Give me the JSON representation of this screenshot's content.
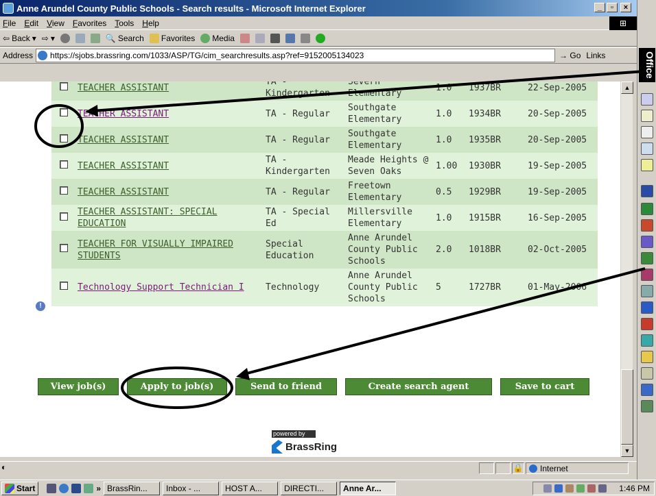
{
  "window": {
    "title": "Anne Arundel County Public Schools - Search results - Microsoft Internet Explorer"
  },
  "menu": [
    "File",
    "Edit",
    "View",
    "Favorites",
    "Tools",
    "Help"
  ],
  "toolbar": {
    "back": "Back",
    "search": "Search",
    "favorites": "Favorites",
    "media": "Media"
  },
  "address": {
    "label": "Address",
    "url": "https://sjobs.brassring.com/1033/ASP/TG/cim_searchresults.asp?ref=9152005134023",
    "go": "Go",
    "links": "Links"
  },
  "jobs": [
    {
      "title": "TEACHER ASSISTANT",
      "type": "TA - Kindergarten",
      "location": "Severn Elementary",
      "fte": "1.0",
      "req": "1937BR",
      "date": "22-Sep-2005"
    },
    {
      "title": "TEACHER ASSISTANT",
      "type": "TA - Regular",
      "location": "Southgate Elementary",
      "fte": "1.0",
      "req": "1934BR",
      "date": "20-Sep-2005"
    },
    {
      "title": "TEACHER ASSISTANT",
      "type": "TA - Regular",
      "location": "Southgate Elementary",
      "fte": "1.0",
      "req": "1935BR",
      "date": "20-Sep-2005"
    },
    {
      "title": "TEACHER ASSISTANT",
      "type": "TA - Kindergarten",
      "location": "Meade Heights @ Seven Oaks",
      "fte": "1.00",
      "req": "1930BR",
      "date": "19-Sep-2005"
    },
    {
      "title": "TEACHER ASSISTANT",
      "type": "TA - Regular",
      "location": "Freetown Elementary",
      "fte": "0.5",
      "req": "1929BR",
      "date": "19-Sep-2005"
    },
    {
      "title": "TEACHER ASSISTANT: SPECIAL EDUCATION",
      "type": "TA - Special Ed",
      "location": "Millersville Elementary",
      "fte": "1.0",
      "req": "1915BR",
      "date": "16-Sep-2005"
    },
    {
      "title": "TEACHER FOR VISUALLY IMPAIRED STUDENTS",
      "type": "Special Education",
      "location": "Anne Arundel County Public Schools",
      "fte": "2.0",
      "req": "1018BR",
      "date": "02-Oct-2005"
    },
    {
      "title": "Technology Support Technician I",
      "type": "Technology",
      "location": "Anne Arundel County Public Schools",
      "fte": "5",
      "req": "1727BR",
      "date": "01-May-2006"
    }
  ],
  "buttons": {
    "view": "View job(s)",
    "apply": "Apply to job(s)",
    "send": "Send to friend",
    "agent": "Create search agent",
    "cart": "Save to cart"
  },
  "powered": {
    "by": "powered by",
    "brand": "BrassRing"
  },
  "status": {
    "zone": "Internet"
  },
  "taskbar": {
    "start": "Start",
    "tasks": [
      "BrassRin...",
      "Inbox - ...",
      "HOST A...",
      "DIRECTI...",
      "Anne Ar..."
    ],
    "time": "1:46 PM"
  },
  "office": {
    "label": "Office"
  }
}
